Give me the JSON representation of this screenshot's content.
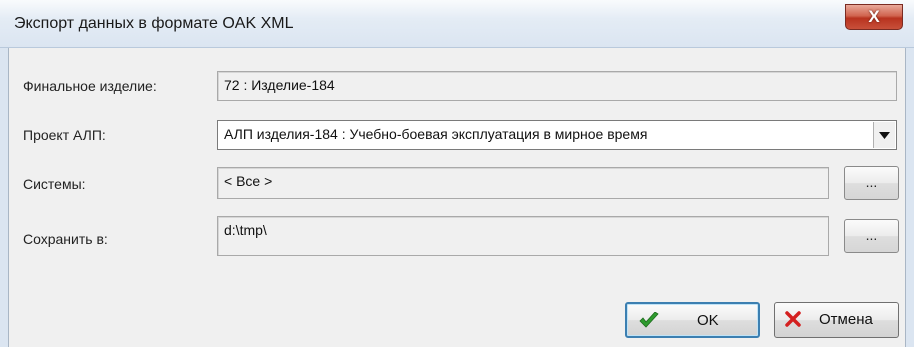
{
  "window": {
    "title": "Экспорт данных в формате OAK XML",
    "close_glyph": "X"
  },
  "form": {
    "final_item_label": "Финальное изделие:",
    "final_item_value": "72 : Изделие-184",
    "project_label": "Проект АЛП:",
    "project_value": "АЛП изделия-184 : Учебно-боевая эксплуатация в мирное время",
    "systems_label": "Системы:",
    "systems_value": "< Все >",
    "systems_browse": "...",
    "save_label": "Сохранить в:",
    "save_value": "d:\\tmp\\",
    "save_browse": "..."
  },
  "buttons": {
    "ok_label": "OK",
    "cancel_label": "Отмена"
  },
  "colors": {
    "ok_check": "#2e9b2e",
    "cancel_x": "#d42020",
    "close_button": "#c8503a"
  }
}
